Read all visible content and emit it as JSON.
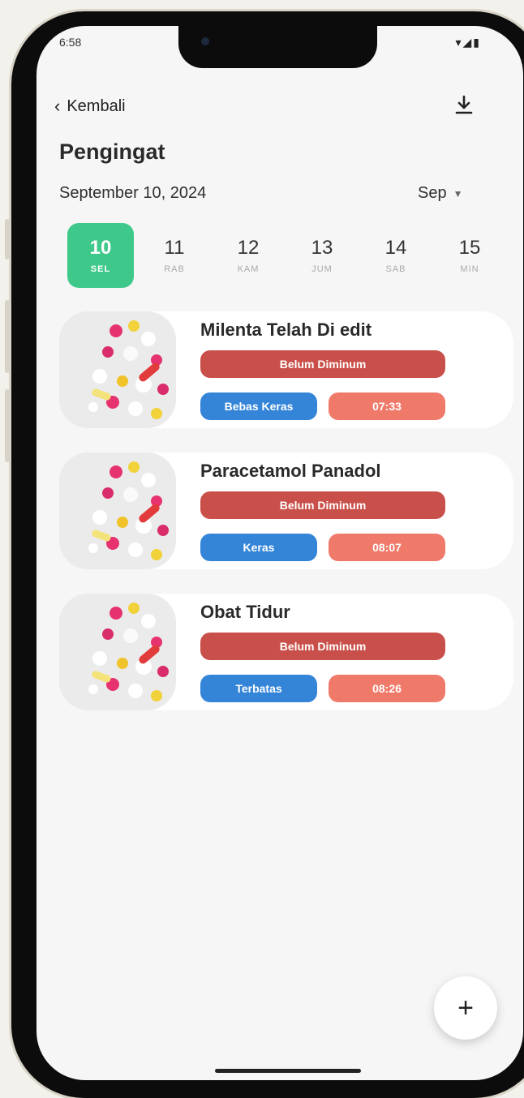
{
  "status_bar": {
    "time": "6:58",
    "icons": "▾◢▮"
  },
  "header": {
    "back_label": "Kembali",
    "back_icon": "chevron-left",
    "download_icon": "download"
  },
  "page_title": "Pengingat",
  "selected_date": "September 10, 2024",
  "month_selector": {
    "value": "Sep"
  },
  "days": [
    {
      "num": "10",
      "weekday": "SEL",
      "active": true
    },
    {
      "num": "11",
      "weekday": "RAB",
      "active": false
    },
    {
      "num": "12",
      "weekday": "KAM",
      "active": false
    },
    {
      "num": "13",
      "weekday": "JUM",
      "active": false
    },
    {
      "num": "14",
      "weekday": "SAB",
      "active": false
    },
    {
      "num": "15",
      "weekday": "MIN",
      "active": false
    }
  ],
  "reminders": [
    {
      "name": "Milenta Telah Di edit",
      "status": "Belum Diminum",
      "category": "Bebas Keras",
      "time": "07:33"
    },
    {
      "name": "Paracetamol Panadol",
      "status": "Belum Diminum",
      "category": "Keras",
      "time": "08:07"
    },
    {
      "name": "Obat Tidur",
      "status": "Belum Diminum",
      "category": "Terbatas",
      "time": "08:26"
    }
  ],
  "fab_label": "+",
  "colors": {
    "accent_green": "#3ec98b",
    "status_red": "#c9504a",
    "category_blue": "#3484d7",
    "time_salmon": "#f07a6a"
  }
}
